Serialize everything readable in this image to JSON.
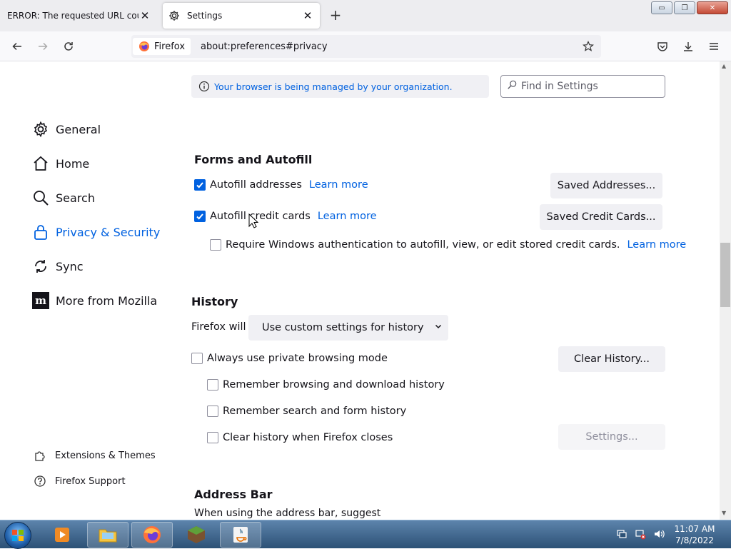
{
  "tabs": [
    {
      "title": "ERROR: The requested URL could not be retrieved",
      "active": false
    },
    {
      "title": "Settings",
      "active": true
    }
  ],
  "window_controls": {
    "minimize": "▭",
    "restore": "❐",
    "close": "✕"
  },
  "navbar": {
    "identity_label": "Firefox",
    "url": "about:preferences#privacy"
  },
  "managed_notice": "Your browser is being managed by your organization.",
  "search": {
    "placeholder": "Find in Settings"
  },
  "sidebar": {
    "items": [
      {
        "label": "General",
        "icon": "gear-icon"
      },
      {
        "label": "Home",
        "icon": "home-icon"
      },
      {
        "label": "Search",
        "icon": "search-icon"
      },
      {
        "label": "Privacy & Security",
        "icon": "lock-icon",
        "active": true
      },
      {
        "label": "Sync",
        "icon": "sync-icon"
      },
      {
        "label": "More from Mozilla",
        "icon": "mozilla-icon"
      }
    ],
    "bottom": [
      {
        "label": "Extensions & Themes",
        "icon": "puzzle-icon"
      },
      {
        "label": "Firefox Support",
        "icon": "help-icon"
      }
    ]
  },
  "forms": {
    "heading": "Forms and Autofill",
    "autofill_addresses": {
      "label": "Autofill addresses",
      "checked": true,
      "link": "Learn more",
      "button": "Saved Addresses..."
    },
    "autofill_cards": {
      "label": "Autofill credit cards",
      "checked": true,
      "link": "Learn more",
      "button": "Saved Credit Cards..."
    },
    "require_auth": {
      "label": "Require Windows authentication to autofill, view, or edit stored credit cards.",
      "checked": false,
      "link": "Learn more"
    }
  },
  "history": {
    "heading": "History",
    "firefox_will": "Firefox will",
    "mode_selected": "Use custom settings for history",
    "private_mode": {
      "label": "Always use private browsing mode",
      "checked": false
    },
    "clear_button": "Clear History...",
    "remember_browsing": {
      "label": "Remember browsing and download history",
      "checked": false
    },
    "remember_search": {
      "label": "Remember search and form history",
      "checked": false
    },
    "clear_on_close": {
      "label": "Clear history when Firefox closes",
      "checked": false
    },
    "settings_button": "Settings..."
  },
  "address_bar": {
    "heading": "Address Bar",
    "subtext": "When using the address bar, suggest"
  },
  "taskbar": {
    "apps": [
      "media-player-icon",
      "file-explorer-icon",
      "firefox-icon",
      "minecraft-icon",
      "java-icon"
    ]
  },
  "clock": {
    "time": "11:07 AM",
    "date": "7/8/2022"
  },
  "colors": {
    "accent": "#0061e0",
    "text": "#15141a",
    "button_bg": "#f0f0f4"
  }
}
